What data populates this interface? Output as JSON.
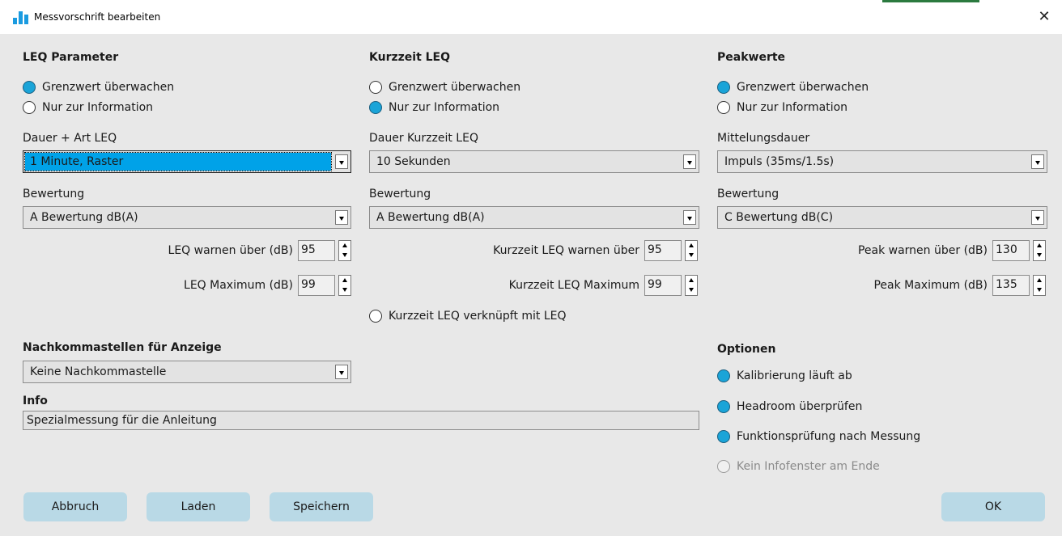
{
  "window": {
    "title": "Messvorschrift bearbeiten",
    "close_glyph": "✕",
    "icon": "bar-chart-icon",
    "accent_color": "#1aa4d8"
  },
  "leq": {
    "heading": "LEQ Parameter",
    "radio_monitor": "Grenzwert überwachen",
    "radio_info": "Nur zur Information",
    "selected_mode": "Grenzwert überwachen",
    "duration_label": "Dauer + Art LEQ",
    "duration_value": "1 Minute, Raster",
    "weighting_label": "Bewertung",
    "weighting_value": "A Bewertung dB(A)",
    "warn_label": "LEQ warnen über (dB)",
    "warn_value": "95",
    "max_label": "LEQ Maximum (dB)",
    "max_value": "99"
  },
  "short": {
    "heading": "Kurzzeit LEQ",
    "radio_monitor": "Grenzwert überwachen",
    "radio_info": "Nur zur Information",
    "selected_mode": "Nur zur Information",
    "duration_label": "Dauer Kurzzeit LEQ",
    "duration_value": "10 Sekunden",
    "weighting_label": "Bewertung",
    "weighting_value": "A Bewertung dB(A)",
    "warn_label": "Kurzzeit LEQ warnen über",
    "warn_value": "95",
    "max_label": "Kurzzeit LEQ Maximum",
    "max_value": "99",
    "linked_label": "Kurzzeit LEQ verknüpft mit LEQ"
  },
  "peak": {
    "heading": "Peakwerte",
    "radio_monitor": "Grenzwert überwachen",
    "radio_info": "Nur zur Information",
    "selected_mode": "Grenzwert überwachen",
    "duration_label": "Mittelungsdauer",
    "duration_value": "Impuls (35ms/1.5s)",
    "weighting_label": "Bewertung",
    "weighting_value": "C Bewertung dB(C)",
    "warn_label": "Peak warnen über (dB)",
    "warn_value": "130",
    "max_label": "Peak Maximum (dB)",
    "max_value": "135"
  },
  "decimals": {
    "heading": "Nachkommastellen für Anzeige",
    "value": "Keine Nachkommastelle"
  },
  "info": {
    "heading": "Info",
    "value": "Spezialmessung für die Anleitung"
  },
  "options": {
    "heading": "Optionen",
    "calibration": "Kalibrierung läuft ab",
    "headroom": "Headroom überprüfen",
    "function_check": "Funktionsprüfung nach Messung",
    "no_info_window": "Kein Infofenster am Ende"
  },
  "buttons": {
    "cancel": "Abbruch",
    "load": "Laden",
    "save": "Speichern",
    "ok": "OK"
  }
}
